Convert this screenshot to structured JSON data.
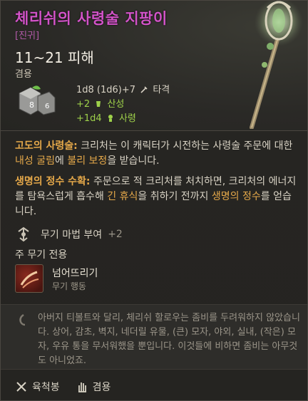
{
  "item": {
    "title": "체리쉬의 사령술 지팡이",
    "rarity": "[진귀]",
    "damage": "11~21 피해",
    "hand": "겸용"
  },
  "dice": {
    "left_face": "8",
    "right_face": "6"
  },
  "stats": {
    "base": "1d8 (1d6)+7",
    "base_type": "타격",
    "bonus1_value": "+2",
    "bonus1_type": "산성",
    "bonus2_value": "+1d4",
    "bonus2_type": "사령"
  },
  "passive": {
    "name": "고도의 사령술:",
    "text_a": " 크리처는 이 캐릭터가 시전하는 사령술 주문에 대한 ",
    "term1": "내성 굴림",
    "text_b": "에 ",
    "term2": "불리 보정",
    "text_c": "을 받습니다."
  },
  "passive2": {
    "name": "생명의 정수 수확:",
    "text_a": " 주문으로 적 크리처를 처치하면, 크리처의 에너지를 탐욕스럽게 흡수해 ",
    "term1": "긴 휴식",
    "text_b": "을 취하기 전까지 ",
    "term2": "생명의 정수",
    "text_c": "를 얻습니다."
  },
  "enchant": {
    "label": "무기 마법 부여",
    "bonus": "+2"
  },
  "main_only": "주 무기 전용",
  "action": {
    "name": "넘어뜨리기",
    "type": "무기 행동"
  },
  "lore": "아버지 티볼트와 달리, 체리쉬 할로우는 좀비를 두려워하지 않았습니다. 상어, 감초, 벽지, 네더릴 유물, (큰) 모자, 야외, 실내, (작은) 모자, 우유 통을 무서워했을 뿐입니다. 이것들에 비하면 좀비는 아무것도 아니었죠.",
  "footer": {
    "proficiency": "육척봉",
    "handedness": "겸용"
  },
  "colors": {
    "title": "#d253c8",
    "green": "#9ed14a",
    "orange": "#e6a94a"
  }
}
